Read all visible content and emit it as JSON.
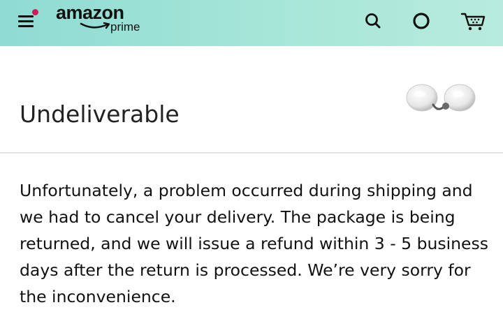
{
  "header": {
    "logo_text": "amazon",
    "logo_sub": "prime",
    "icons": {
      "menu": "menu-icon",
      "notification_dot_color": "#d0195b",
      "search": "search-icon",
      "alexa": "alexa-icon",
      "cart": "cart-icon"
    }
  },
  "order": {
    "status_title": "Undeliverable",
    "product_image": "earbuds-image",
    "message": "Unfortunately, a problem occurred during shipping and we had to cancel your delivery. The package is being returned, and we will issue a refund within 3 - 5 business days after the return is processed. We’re very sorry for the inconvenience."
  },
  "colors": {
    "header_gradient_start": "#8fdbd3",
    "header_gradient_end": "#b8ebdd"
  }
}
